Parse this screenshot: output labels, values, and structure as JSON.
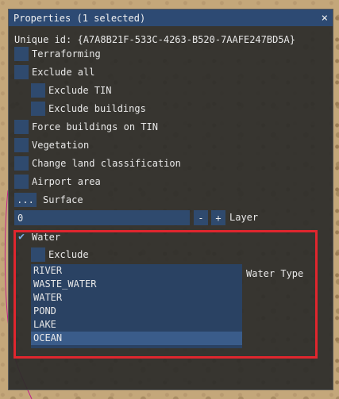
{
  "window": {
    "title": "Properties (1 selected)",
    "close_glyph": "×"
  },
  "unique_id": "Unique id: {A7A8B21F-533C-4263-B520-7AAFE247BD5A}",
  "options": {
    "terraforming": "Terraforming",
    "exclude_all": "Exclude all",
    "exclude_tin": "Exclude TIN",
    "exclude_buildings": "Exclude buildings",
    "force_buildings_on_tin": "Force buildings on TIN",
    "vegetation": "Vegetation",
    "change_land_classification": "Change land classification",
    "airport_area": "Airport area"
  },
  "surface": {
    "button_label": "...",
    "label": "Surface"
  },
  "layer": {
    "value": "0",
    "minus": "-",
    "plus": "+",
    "label": "Layer"
  },
  "water": {
    "label": "Water",
    "checked": true,
    "check_glyph": "✔",
    "exclude_label": "Exclude",
    "type_label": "Water Type",
    "types": [
      "RIVER",
      "WASTE_WATER",
      "WATER",
      "POND",
      "LAKE",
      "OCEAN"
    ],
    "selected_type": "OCEAN"
  },
  "colors": {
    "title_bar": "#2d4a73",
    "highlight_border": "#e0262e",
    "checkbox": "#2f4a6e"
  }
}
